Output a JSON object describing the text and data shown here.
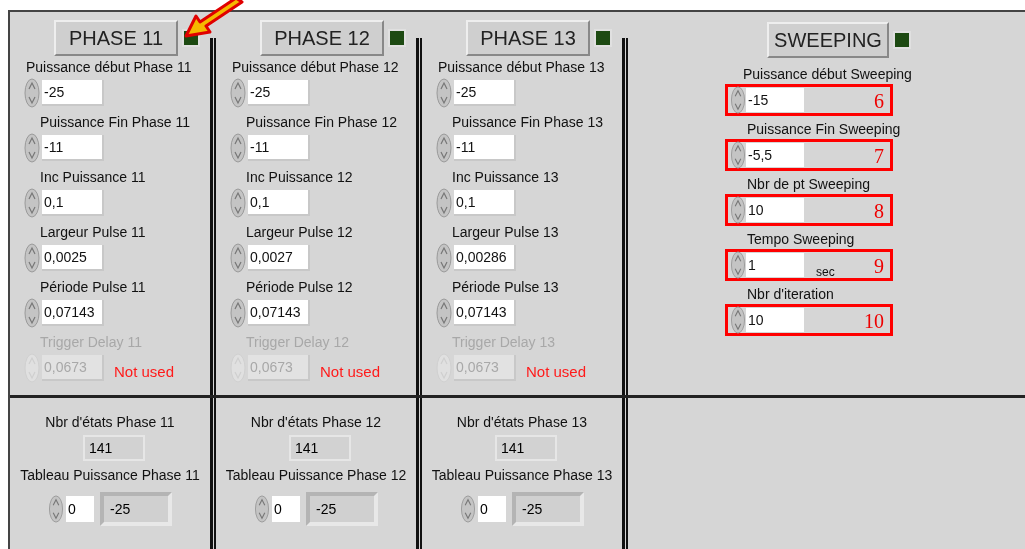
{
  "phases": [
    {
      "button": "PHASE 11",
      "led_on": false,
      "fields": [
        {
          "label": "Puissance début Phase 11",
          "value": "-25",
          "disabled": false
        },
        {
          "label": "Puissance Fin Phase 11",
          "value": "-11",
          "disabled": false
        },
        {
          "label": "Inc Puissance 11",
          "value": "0,1",
          "disabled": false
        },
        {
          "label": "Largeur Pulse 11",
          "value": "0,0025",
          "disabled": false
        },
        {
          "label": "Période Pulse 11",
          "value": "0,07143",
          "disabled": false
        },
        {
          "label": "Trigger Delay 11",
          "value": "0,0673",
          "disabled": true,
          "note": "Not used"
        }
      ],
      "count_label": "Nbr d'états Phase 11",
      "count": "141",
      "array_label": "Tableau Puissance Phase 11",
      "array_index": "0",
      "array_value": "-25"
    },
    {
      "button": "PHASE 12",
      "led_on": false,
      "fields": [
        {
          "label": "Puissance début Phase 12",
          "value": "-25",
          "disabled": false
        },
        {
          "label": "Puissance Fin Phase 12",
          "value": "-11",
          "disabled": false
        },
        {
          "label": "Inc Puissance 12",
          "value": "0,1",
          "disabled": false
        },
        {
          "label": "Largeur Pulse 12",
          "value": "0,0027",
          "disabled": false
        },
        {
          "label": "Période Pulse 12",
          "value": "0,07143",
          "disabled": false
        },
        {
          "label": "Trigger Delay 12",
          "value": "0,0673",
          "disabled": true,
          "note": "Not used"
        }
      ],
      "count_label": "Nbr d'états Phase 12",
      "count": "141",
      "array_label": "Tableau Puissance Phase 12",
      "array_index": "0",
      "array_value": "-25"
    },
    {
      "button": "PHASE 13",
      "led_on": false,
      "fields": [
        {
          "label": "Puissance début Phase 13",
          "value": "-25",
          "disabled": false
        },
        {
          "label": "Puissance Fin Phase 13",
          "value": "-11",
          "disabled": false
        },
        {
          "label": "Inc Puissance 13",
          "value": "0,1",
          "disabled": false
        },
        {
          "label": "Largeur Pulse 13",
          "value": "0,00286",
          "disabled": false
        },
        {
          "label": "Période Pulse 13",
          "value": "0,07143",
          "disabled": false
        },
        {
          "label": "Trigger Delay 13",
          "value": "0,0673",
          "disabled": true,
          "note": "Not used"
        }
      ],
      "count_label": "Nbr d'états Phase 13",
      "count": "141",
      "array_label": "Tableau Puissance Phase 13",
      "array_index": "0",
      "array_value": "-25"
    }
  ],
  "sweeping": {
    "button": "SWEEPING",
    "led_on": false,
    "fields": [
      {
        "label": "Puissance début Sweeping",
        "value": "-15",
        "marker": "6"
      },
      {
        "label": "Puissance Fin Sweeping",
        "value": "-5,5",
        "marker": "7"
      },
      {
        "label": "Nbr de pt Sweeping",
        "value": "10",
        "marker": "8"
      },
      {
        "label": "Tempo Sweeping",
        "value": "1",
        "unit": "sec",
        "marker": "9"
      },
      {
        "label": "Nbr d'iteration",
        "value": "10",
        "marker": "10"
      }
    ]
  }
}
